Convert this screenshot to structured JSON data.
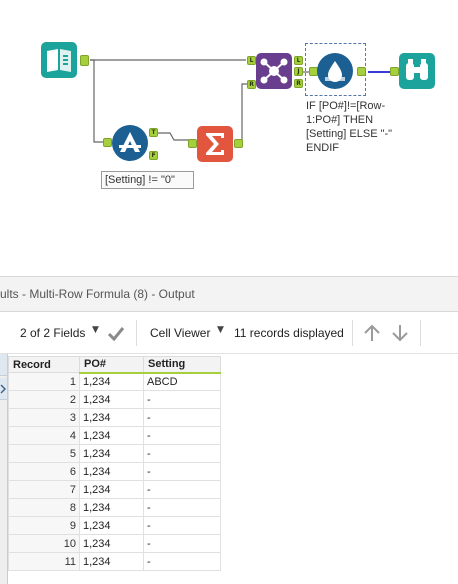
{
  "canvas": {
    "tools": {
      "input": {
        "icon": "book-icon",
        "color": "#1ba39c"
      },
      "filter": {
        "icon": "filter-icon",
        "color": "#1c5f93",
        "true_label": "T",
        "false_label": "F"
      },
      "summarize": {
        "icon": "sigma-icon",
        "color": "#e2553f"
      },
      "join": {
        "icon": "join-icon",
        "color": "#6a3e8e",
        "left_label": "L",
        "join_label": "J",
        "right_label": "R"
      },
      "multirow": {
        "icon": "water-drop-icon",
        "color": "#1c5f93"
      },
      "browse": {
        "icon": "binoculars-icon",
        "color": "#1ba39c"
      }
    },
    "annotations": {
      "filter_expression": "[Setting] != \"0\"",
      "multirow_line1": "IF [PO#]!=[Row-",
      "multirow_line2": "1:PO#] THEN",
      "multirow_line3": "[Setting] ELSE \"-\"",
      "multirow_line4": "ENDIF"
    }
  },
  "results": {
    "title": "ults - Multi-Row Formula (8) - Output",
    "toolbar": {
      "fields_label": "2 of 2 Fields",
      "cell_viewer_label": "Cell Viewer",
      "records_label": "11 records displayed"
    },
    "columns": {
      "record": "Record",
      "po": "PO#",
      "setting": "Setting"
    },
    "rows": [
      {
        "n": "1",
        "po": "1,234",
        "setting": "ABCD"
      },
      {
        "n": "2",
        "po": "1,234",
        "setting": "-"
      },
      {
        "n": "3",
        "po": "1,234",
        "setting": "-"
      },
      {
        "n": "4",
        "po": "1,234",
        "setting": "-"
      },
      {
        "n": "5",
        "po": "1,234",
        "setting": "-"
      },
      {
        "n": "6",
        "po": "1,234",
        "setting": "-"
      },
      {
        "n": "7",
        "po": "1,234",
        "setting": "-"
      },
      {
        "n": "8",
        "po": "1,234",
        "setting": "-"
      },
      {
        "n": "9",
        "po": "1,234",
        "setting": "-"
      },
      {
        "n": "10",
        "po": "1,234",
        "setting": "-"
      },
      {
        "n": "11",
        "po": "1,234",
        "setting": "-"
      }
    ]
  },
  "colors": {
    "anchor": "#a6cf3c",
    "wire": "#666666",
    "selected_wire": "#3a3ad8"
  }
}
